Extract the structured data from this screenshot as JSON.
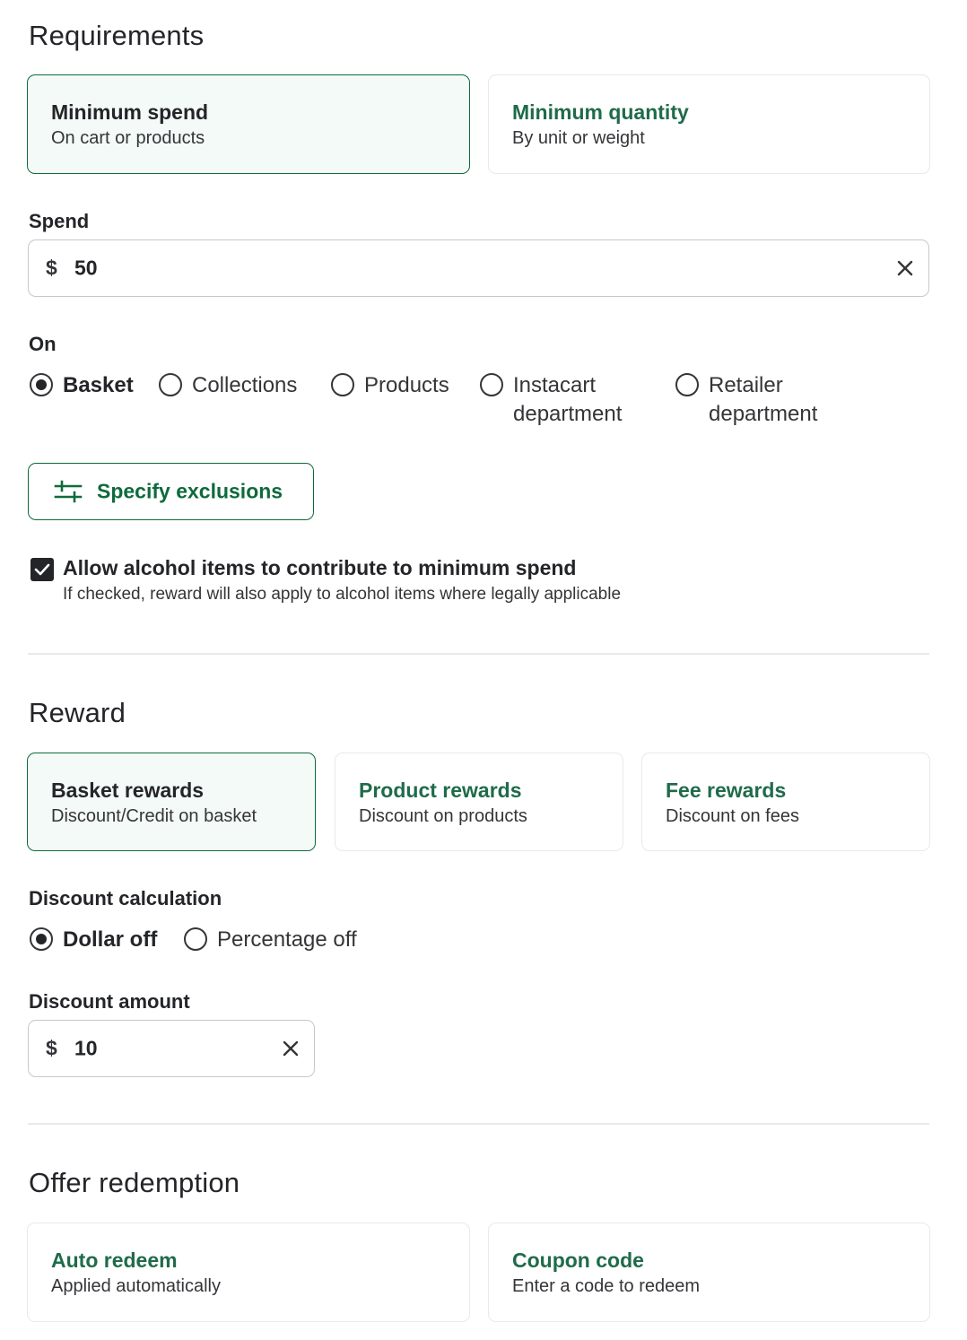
{
  "requirements": {
    "title": "Requirements",
    "cards": [
      {
        "title": "Minimum spend",
        "subtitle": "On cart or products",
        "selected": true
      },
      {
        "title": "Minimum quantity",
        "subtitle": "By unit or weight",
        "selected": false
      }
    ],
    "spend": {
      "label": "Spend",
      "currency": "$",
      "value": "50"
    },
    "on": {
      "label": "On",
      "options": [
        {
          "label": "Basket",
          "selected": true
        },
        {
          "label": "Collections",
          "selected": false
        },
        {
          "label": "Products",
          "selected": false
        },
        {
          "label": "Instacart department",
          "selected": false
        },
        {
          "label": "Retailer department",
          "selected": false
        }
      ]
    },
    "exclusions_button": "Specify exclusions",
    "alcohol": {
      "checked": true,
      "label": "Allow alcohol items to contribute to minimum spend",
      "help": "If checked, reward will also apply to alcohol items where legally applicable"
    }
  },
  "reward": {
    "title": "Reward",
    "cards": [
      {
        "title": "Basket rewards",
        "subtitle": "Discount/Credit on basket",
        "selected": true
      },
      {
        "title": "Product rewards",
        "subtitle": "Discount on products",
        "selected": false
      },
      {
        "title": "Fee rewards",
        "subtitle": "Discount on fees",
        "selected": false
      }
    ],
    "calculation": {
      "label": "Discount calculation",
      "options": [
        {
          "label": "Dollar off",
          "selected": true
        },
        {
          "label": "Percentage off",
          "selected": false
        }
      ]
    },
    "amount": {
      "label": "Discount amount",
      "currency": "$",
      "value": "10"
    }
  },
  "redemption": {
    "title": "Offer redemption",
    "cards": [
      {
        "title": "Auto redeem",
        "subtitle": "Applied automatically",
        "selected": false
      },
      {
        "title": "Coupon code",
        "subtitle": "Enter a code to redeem",
        "selected": false
      }
    ]
  },
  "colors": {
    "accent": "#0e6a3c",
    "selected_bg": "#f4faf7",
    "border": "#e8e9eb",
    "text": "#242529"
  }
}
